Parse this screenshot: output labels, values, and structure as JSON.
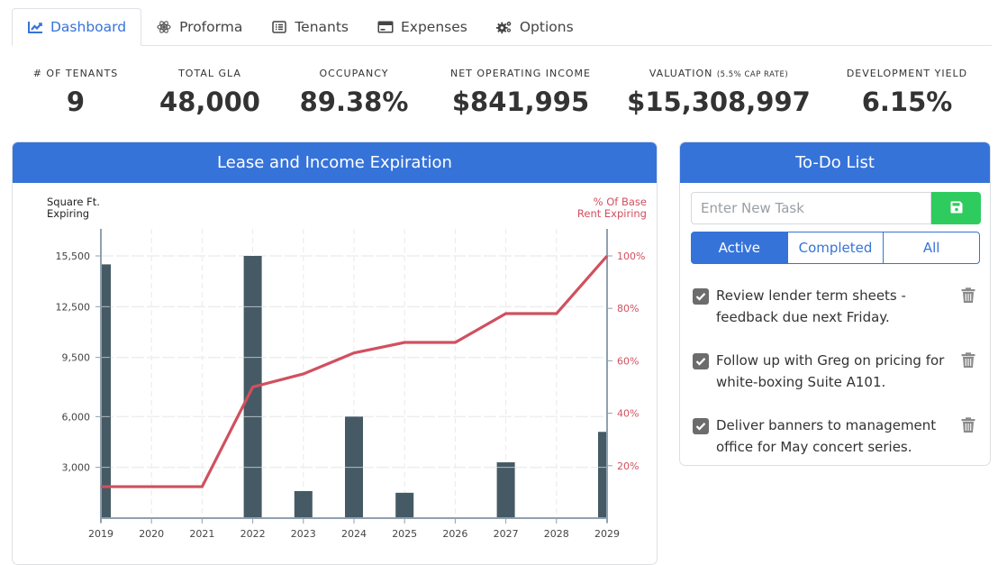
{
  "tabs": [
    {
      "label": "Dashboard",
      "icon": "chart-line-icon",
      "active": true
    },
    {
      "label": "Proforma",
      "icon": "atom-icon",
      "active": false
    },
    {
      "label": "Tenants",
      "icon": "list-icon",
      "active": false
    },
    {
      "label": "Expenses",
      "icon": "credit-card-icon",
      "active": false
    },
    {
      "label": "Options",
      "icon": "gears-icon",
      "active": false
    }
  ],
  "stats": [
    {
      "label": "# OF TENANTS",
      "sub": "",
      "value": "9"
    },
    {
      "label": "TOTAL GLA",
      "sub": "",
      "value": "48,000"
    },
    {
      "label": "OCCUPANCY",
      "sub": "",
      "value": "89.38%"
    },
    {
      "label": "NET OPERATING INCOME",
      "sub": "",
      "value": "$841,995"
    },
    {
      "label": "VALUATION",
      "sub": "(5.5% CAP RATE)",
      "value": "$15,308,997"
    },
    {
      "label": "DEVELOPMENT YIELD",
      "sub": "",
      "value": "6.15%"
    }
  ],
  "lease_card": {
    "title": "Lease and Income Expiration",
    "left_axis_title_line1": "Square Ft.",
    "left_axis_title_line2": "Expiring",
    "right_axis_title_line1": "% Of Base",
    "right_axis_title_line2": "Rent Expiring"
  },
  "chart_data": {
    "type": "bar",
    "title": "Lease and Income Expiration",
    "xlabel": "",
    "ylabel": "Square Ft. Expiring",
    "y2label": "% Of Base Rent Expiring",
    "categories": [
      "2019",
      "2020",
      "2021",
      "2022",
      "2023",
      "2024",
      "2025",
      "2026",
      "2027",
      "2028",
      "2029"
    ],
    "series": [
      {
        "name": "Square Ft. Expiring",
        "type": "bar",
        "axis": "left",
        "color": "#455a64",
        "values": [
          15000,
          0,
          0,
          15500,
          1600,
          6000,
          1500,
          0,
          3300,
          0,
          5100
        ]
      },
      {
        "name": "% Of Base Rent Expiring",
        "type": "line",
        "axis": "right",
        "color": "#d0505f",
        "values": [
          12,
          12,
          12,
          50,
          55,
          63,
          67,
          67,
          78,
          78,
          100
        ]
      }
    ],
    "ylim": [
      0,
      15500
    ],
    "yticks": [
      3000,
      6000,
      9500,
      12500,
      15500
    ],
    "ytick_labels": [
      "3,000",
      "6,000",
      "9,500",
      "12,500",
      "15,500"
    ],
    "y2lim": [
      0,
      100
    ],
    "y2ticks": [
      20,
      40,
      60,
      80,
      100
    ],
    "y2tick_labels": [
      "20%",
      "40%",
      "60%",
      "80%",
      "100%"
    ],
    "grid": true,
    "legend": "none"
  },
  "todo": {
    "title": "To-Do List",
    "input_value": "",
    "input_placeholder": "Enter New Task",
    "save_icon": "floppy-disk-icon",
    "filters": [
      {
        "label": "Active",
        "active": true
      },
      {
        "label": "Completed",
        "active": false
      },
      {
        "label": "All",
        "active": false
      }
    ],
    "items": [
      {
        "text": "Review lender term sheets - feedback due next Friday.",
        "checked": true
      },
      {
        "text": "Follow up with Greg on pricing for white-boxing Suite A101.",
        "checked": true
      },
      {
        "text": "Deliver banners to management office for May concert series.",
        "checked": true
      }
    ]
  },
  "colors": {
    "primary": "#3673d9",
    "success": "#2ecc5f",
    "bar": "#455a64",
    "line": "#d0505f"
  }
}
